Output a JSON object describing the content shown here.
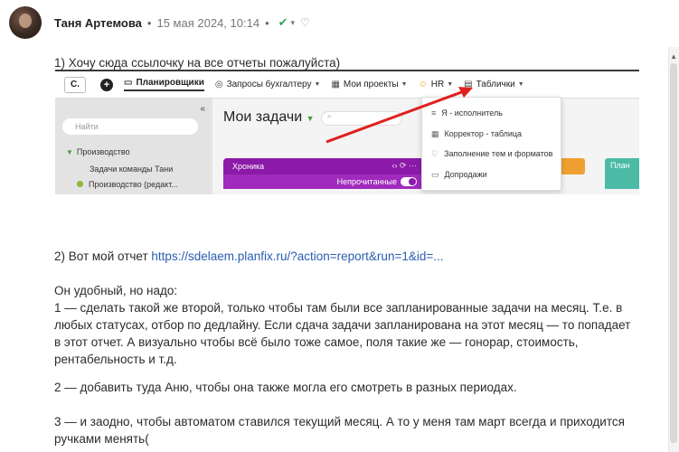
{
  "post": {
    "author": "Таня Артемова",
    "separator": "•",
    "timestamp": "15 мая 2024, 10:14",
    "separator2": "•",
    "check_icon": "check-icon",
    "reaction_icon": "heart-icon"
  },
  "body": {
    "line1": "1) Хочу сюда ссылочку на все отчеты пожалуйста)",
    "line2_prefix": "2) Вот мой отчет ",
    "line2_link": "https://sdelaem.planfix.ru/?action=report&run=1&id=...",
    "p1": "Он удобный, но надо:",
    "p2_l1": "1 — сделать такой же второй, только чтобы там были все запланированные задачи на месяц. Т.е. в",
    "p2_l2": "любых статусах, отбор по дедлайну. Если сдача задачи запланирована на этот месяц — то попадает",
    "p2_l3": "в этот отчет. А визуально чтобы всё было тоже самое, поля такие же — гонорар, стоимость,",
    "p2_l4": "рентабельность и т.д.",
    "p3": "2 — добавить туда Аню, чтобы она также могла его смотреть в разных периодах.",
    "p4_l1": "3 — и заодно, чтобы автоматом ставился текущий месяц. А то у меня там март всегда и приходится",
    "p4_l2": "ручками менять("
  },
  "screenshot": {
    "logo": "С.",
    "plus": "+",
    "nav": [
      {
        "label": "Планировщики",
        "icon": "▭"
      },
      {
        "label": "Запросы бухгалтеру",
        "icon": "◎"
      },
      {
        "label": "Мои проекты",
        "icon": "▦"
      },
      {
        "label": "HR",
        "icon": "☺"
      },
      {
        "label": "Таблички",
        "icon": "▤"
      }
    ],
    "sidebar": {
      "collapse": "«",
      "search_placeholder": "Найти",
      "item1": "Производство",
      "item2": "Задачи команды Тани",
      "item3": "Производство (редакт..."
    },
    "main_title": "Мои задачи",
    "card_title": "Хроника",
    "card_unread": "Непрочитанные",
    "teal_title": "План",
    "dropdown": [
      "Я - исполнитель",
      "Корректор - таблица",
      "Заполнение тем и форматов",
      "Допродажи"
    ]
  }
}
